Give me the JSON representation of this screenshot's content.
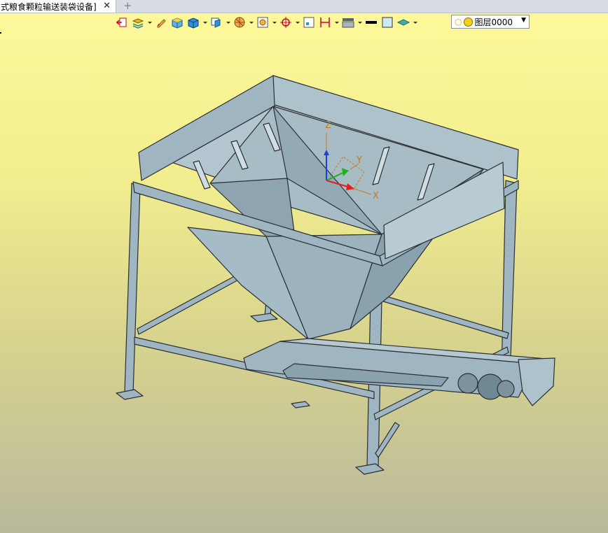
{
  "tab": {
    "title": "式粮食颗粒输送装袋设备]",
    "close": "✕",
    "add": "+"
  },
  "toolbar": {
    "icons": [
      "exit-view-icon",
      "layer-stack-icon",
      "pencil-icon",
      "box-solid-icon",
      "cube-shaded-icon",
      "cube-view-icon",
      "sphere-icon",
      "fit-view-icon",
      "origin-icon",
      "frame-icon",
      "dimension-icon",
      "display-mode-icon",
      "line-color-icon",
      "fill-color-icon",
      "material-icon"
    ]
  },
  "layer": {
    "label": "图层0000"
  },
  "axes": {
    "x": "X",
    "y": "Y",
    "z": "Z"
  },
  "colors": {
    "steel": "#9fb6c2",
    "steel_dark": "#6e8894",
    "outline": "#2a2f33",
    "axis_x": "#e21d1d",
    "axis_y": "#1fb21f",
    "axis_z": "#1b3fe0",
    "axis_label": "#c87a10"
  }
}
